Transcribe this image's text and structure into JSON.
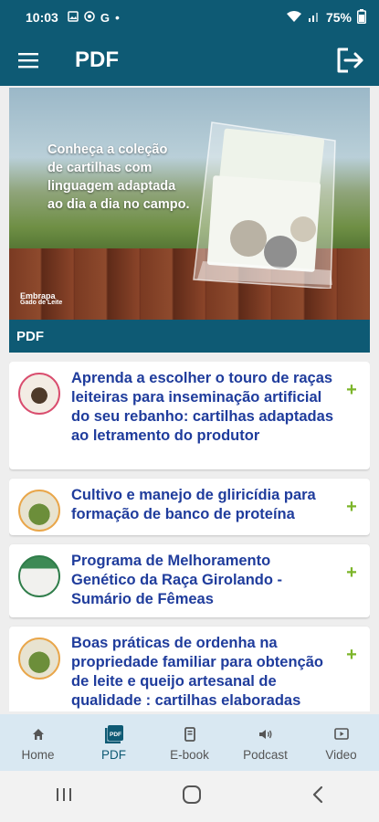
{
  "status_bar": {
    "time": "10:03",
    "notification_g": "G",
    "dot": "•",
    "battery": "75%"
  },
  "app_bar": {
    "title": "PDF"
  },
  "banner": {
    "lines": [
      "Conheça a coleção",
      "de cartilhas com",
      "linguagem adaptada",
      "ao dia a dia no campo."
    ],
    "logo_top": "Embrapa",
    "logo_bottom": "Gado de Leite"
  },
  "section": {
    "title": "PDF"
  },
  "items": [
    {
      "title": "Aprenda a escolher o touro de raças leiteiras para inseminação artificial do seu rebanho: cartilhas adaptadas ao letramento do produtor",
      "action": "+"
    },
    {
      "title": "Cultivo e manejo de gliricídia para formação de banco de proteína",
      "action": "+"
    },
    {
      "title": "Programa de Melhoramento Genético da Raça Girolando - Sumário de Fêmeas",
      "action": "+"
    },
    {
      "title": "Boas práticas de ordenha na propriedade familiar para obtenção de leite e queijo artesanal de qualidade : cartilhas elaboradas conforme metologia e-Rural",
      "action": "+"
    }
  ],
  "bottom_nav": [
    {
      "label": "Home",
      "icon": "home-icon"
    },
    {
      "label": "PDF",
      "icon": "pdf-icon",
      "active": true
    },
    {
      "label": "E-book",
      "icon": "ebook-icon"
    },
    {
      "label": "Podcast",
      "icon": "podcast-icon"
    },
    {
      "label": "Video",
      "icon": "video-icon"
    }
  ],
  "colors": {
    "primary": "#0e5a74",
    "title_blue": "#1f3c9c",
    "plus_green": "#7cb52a",
    "nav_bg": "#d9e8f2"
  }
}
